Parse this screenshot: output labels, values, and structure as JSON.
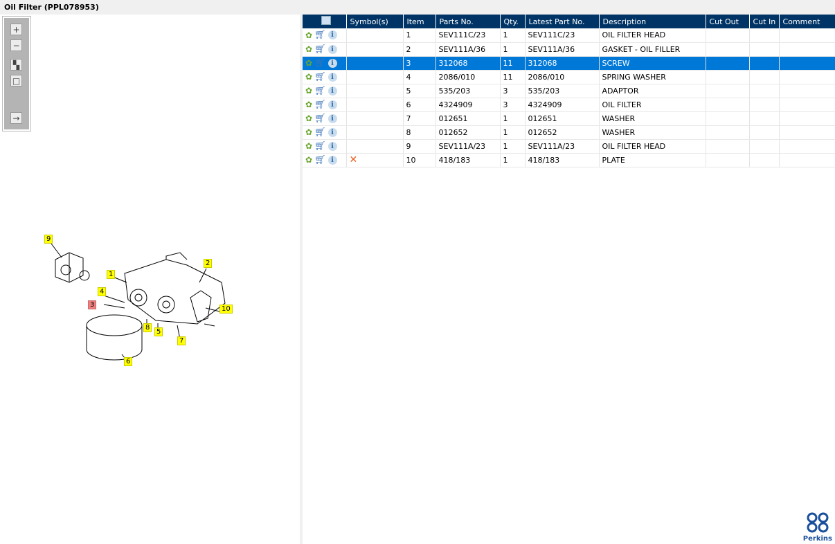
{
  "title": "Oil Filter (PPL078953)",
  "toolbar": {
    "zoom_in": "zoom-in",
    "zoom_out": "zoom-out",
    "fit": "fit",
    "actual": "actual-size",
    "export": "export"
  },
  "callouts": [
    {
      "label": "9",
      "highlight": false
    },
    {
      "label": "1",
      "highlight": false
    },
    {
      "label": "2",
      "highlight": false
    },
    {
      "label": "4",
      "highlight": false
    },
    {
      "label": "3",
      "highlight": true
    },
    {
      "label": "10",
      "highlight": false
    },
    {
      "label": "8",
      "highlight": false
    },
    {
      "label": "5",
      "highlight": false
    },
    {
      "label": "7",
      "highlight": false
    },
    {
      "label": "6",
      "highlight": false
    }
  ],
  "table": {
    "headers": [
      "",
      "Symbol(s)",
      "Item",
      "Parts No.",
      "Qty.",
      "Latest Part No.",
      "Description",
      "Cut Out",
      "Cut In",
      "Comment"
    ],
    "selected_item": "3",
    "rows": [
      {
        "symbol": "",
        "item": "1",
        "part": "SEV111C/23",
        "qty": "1",
        "latest": "SEV111C/23",
        "desc": "OIL FILTER HEAD"
      },
      {
        "symbol": "",
        "item": "2",
        "part": "SEV111A/36",
        "qty": "1",
        "latest": "SEV111A/36",
        "desc": "GASKET - OIL FILLER"
      },
      {
        "symbol": "",
        "item": "3",
        "part": "312068",
        "qty": "11",
        "latest": "312068",
        "desc": "SCREW"
      },
      {
        "symbol": "",
        "item": "4",
        "part": "2086/010",
        "qty": "11",
        "latest": "2086/010",
        "desc": "SPRING WASHER"
      },
      {
        "symbol": "",
        "item": "5",
        "part": "535/203",
        "qty": "3",
        "latest": "535/203",
        "desc": "ADAPTOR"
      },
      {
        "symbol": "",
        "item": "6",
        "part": "4324909",
        "qty": "3",
        "latest": "4324909",
        "desc": "OIL FILTER"
      },
      {
        "symbol": "",
        "item": "7",
        "part": "012651",
        "qty": "1",
        "latest": "012651",
        "desc": "WASHER"
      },
      {
        "symbol": "",
        "item": "8",
        "part": "012652",
        "qty": "1",
        "latest": "012652",
        "desc": "WASHER"
      },
      {
        "symbol": "",
        "item": "9",
        "part": "SEV111A/23",
        "qty": "1",
        "latest": "SEV111A/23",
        "desc": "OIL FILTER HEAD"
      },
      {
        "symbol": "x",
        "item": "10",
        "part": "418/183",
        "qty": "1",
        "latest": "418/183",
        "desc": "PLATE"
      }
    ]
  },
  "logo": "Perkins",
  "colors": {
    "header": "#003466",
    "selected": "#0078d7",
    "callout": "#ffff00",
    "callout_highlight": "#f08080"
  }
}
